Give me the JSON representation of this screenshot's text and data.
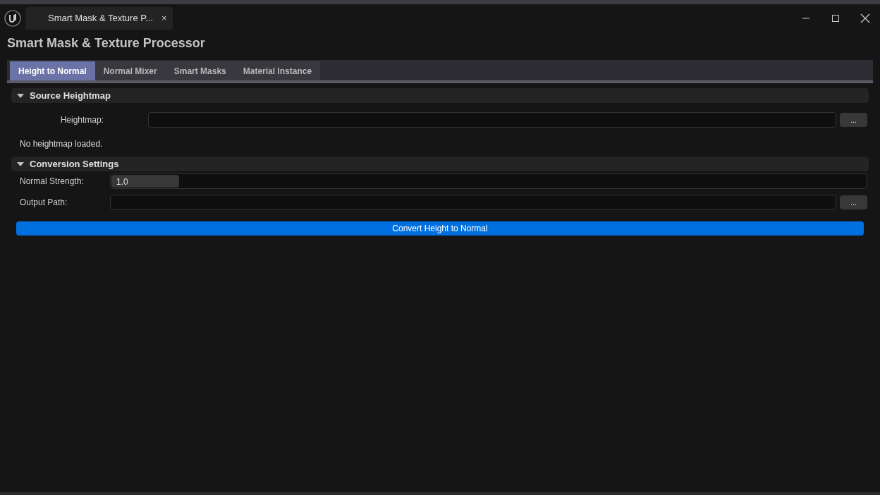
{
  "window": {
    "tab_title": "Smart Mask & Texture P...",
    "tab_close": "×"
  },
  "heading": "Smart Mask & Texture Processor",
  "tabs": [
    {
      "label": "Height to Normal",
      "selected": true
    },
    {
      "label": "Normal Mixer",
      "selected": false
    },
    {
      "label": "Smart Masks",
      "selected": false
    },
    {
      "label": "Material Instance",
      "selected": false
    }
  ],
  "source_section": {
    "title": "Source Heightmap",
    "expanded": true,
    "heightmap_label": "Heightmap:",
    "browse": "...",
    "status": "No heightmap loaded."
  },
  "conversion_section": {
    "title": "Conversion Settings",
    "expanded": true,
    "strength_label": "Normal Strength:",
    "strength_value": "1.0",
    "strength": {
      "level": 0.09
    },
    "output_label": "Output Path:",
    "browse": "..."
  },
  "convert_button": "Convert Height to Normal"
}
